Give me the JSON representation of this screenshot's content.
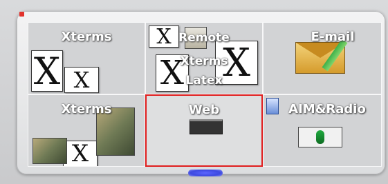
{
  "pager": {
    "desktops": [
      {
        "label": "Xterms"
      },
      {
        "label": "Remote",
        "sublabel1": "Xterms",
        "sublabel2": "Latex"
      },
      {
        "label": "E-mail"
      },
      {
        "label": "Xterms"
      },
      {
        "label": "Web"
      },
      {
        "label": "AIM&Radio"
      }
    ],
    "active_index": 4
  },
  "colors": {
    "active_border": "#e01d1d",
    "indicator": "#4b55f0"
  }
}
